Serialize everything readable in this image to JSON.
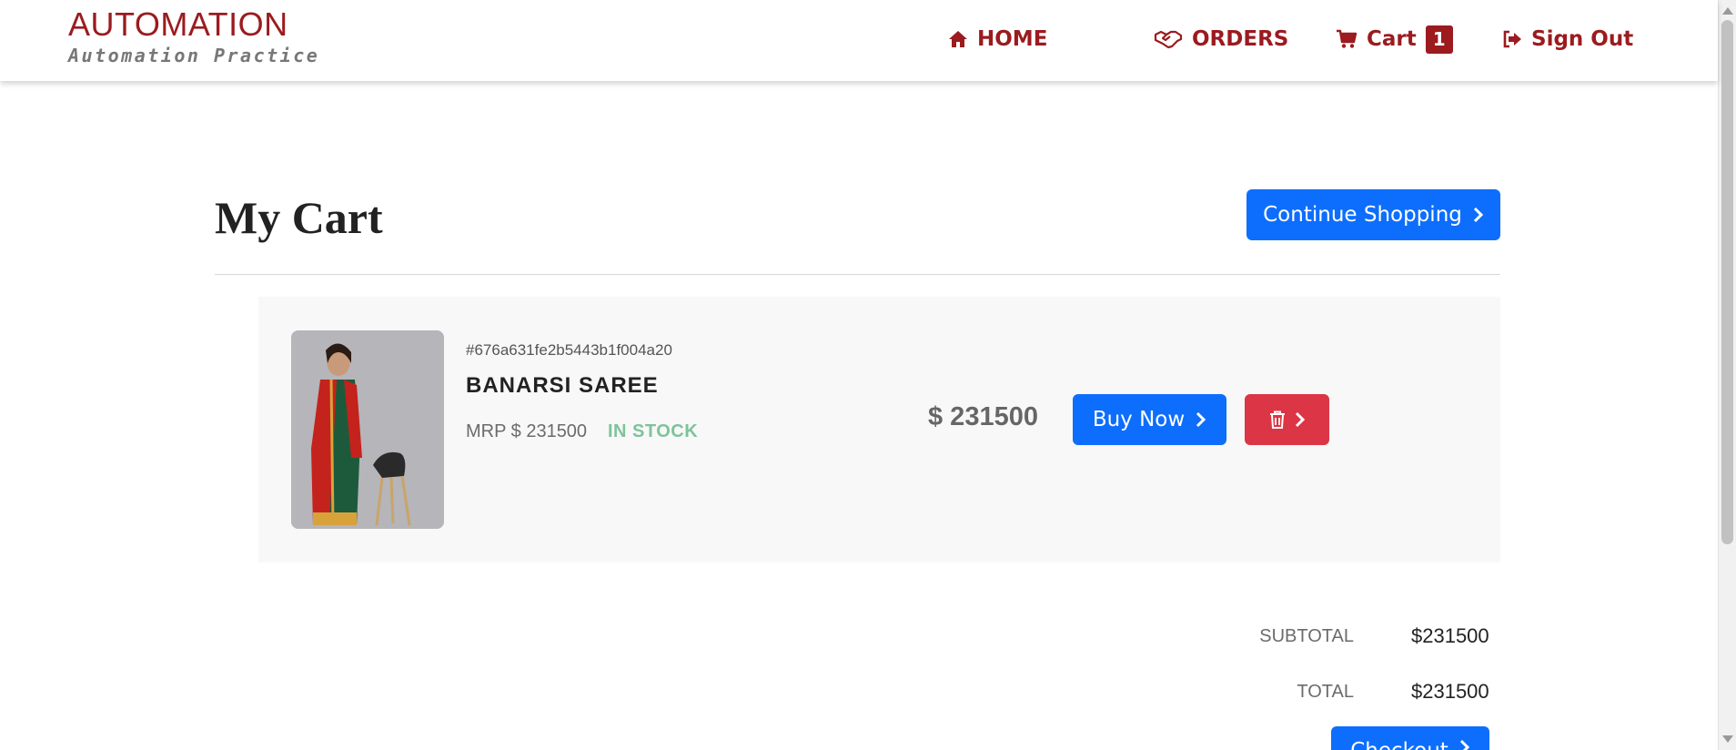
{
  "brand": {
    "title": "AUTOMATION",
    "subtitle": "Automation Practice",
    "color": "#9b1b1f"
  },
  "nav": {
    "home": "HOME",
    "orders": "ORDERS",
    "cart": "Cart",
    "cart_count": "1",
    "signout": "Sign Out",
    "icons": [
      "home-icon",
      "handshake-icon",
      "cart-icon",
      "sign-out-icon"
    ]
  },
  "page": {
    "title": "My Cart",
    "continue_label": "Continue Shopping"
  },
  "item": {
    "id": "#676a631fe2b5443b1f004a20",
    "name": "BANARSI SAREE",
    "mrp": "MRP $ 231500",
    "stock": "IN STOCK",
    "price": "$ 231500",
    "buy_label": "Buy Now",
    "image": "saree-product-image"
  },
  "totals": {
    "subtotal_label": "SUBTOTAL",
    "subtotal_value": "$231500",
    "total_label": "TOTAL",
    "total_value": "$231500",
    "checkout_label": "Checkout"
  },
  "colors": {
    "primary_button": "#0d6efd",
    "danger_button": "#dc3545",
    "in_stock": "#7ec39a"
  }
}
